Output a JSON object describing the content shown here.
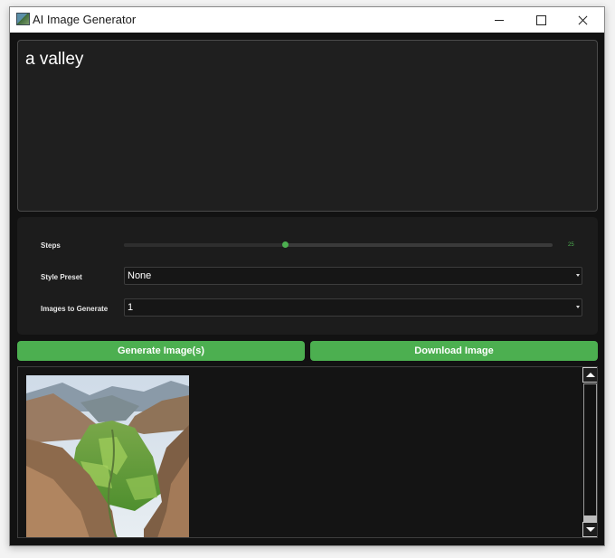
{
  "window": {
    "title": "AI Image Generator",
    "icon": "app-icon"
  },
  "prompt": {
    "value": "a valley"
  },
  "settings": {
    "steps": {
      "label": "Steps",
      "value": "25",
      "fraction": 0.375
    },
    "style_preset": {
      "label": "Style Preset",
      "selected": "None"
    },
    "images_to_generate": {
      "label": "Images to Generate",
      "selected": "1"
    }
  },
  "buttons": {
    "generate_label": "Generate Image(s)",
    "download_label": "Download Image"
  },
  "gallery": {
    "images": [
      {
        "subject": "green valley between mountains"
      }
    ]
  },
  "colors": {
    "accent": "#4caf50",
    "background": "#121212",
    "panel": "#1c1c1c"
  }
}
